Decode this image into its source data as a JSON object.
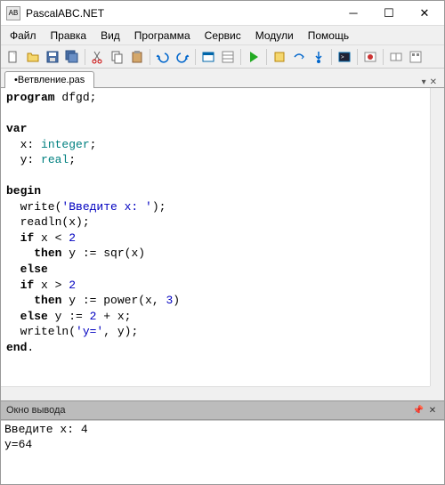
{
  "window": {
    "title": "PascalABC.NET",
    "icon_label": "AB"
  },
  "menu": {
    "file": "Файл",
    "edit": "Правка",
    "view": "Вид",
    "program": "Программа",
    "service": "Сервис",
    "modules": "Модули",
    "help": "Помощь"
  },
  "tabs": {
    "active": "•Ветвление.pas",
    "dropdown": "▾",
    "close": "✕"
  },
  "code": {
    "l1a": "program",
    "l1b": " dfgd;",
    "l3": "var",
    "l4a": "  x: ",
    "l4b": "integer",
    "l4c": ";",
    "l5a": "  y: ",
    "l5b": "real",
    "l5c": ";",
    "l7": "begin",
    "l8a": "  write(",
    "l8b": "'Введите x: '",
    "l8c": ");",
    "l9": "  readln(x);",
    "l10a": "  ",
    "l10b": "if",
    "l10c": " x < ",
    "l10d": "2",
    "l11a": "    ",
    "l11b": "then",
    "l11c": " y := sqr(x)",
    "l12a": "  ",
    "l12b": "else",
    "l13a": "  ",
    "l13b": "if",
    "l13c": " x > ",
    "l13d": "2",
    "l14a": "    ",
    "l14b": "then",
    "l14c": " y := power(x, ",
    "l14d": "3",
    "l14e": ")",
    "l15a": "  ",
    "l15b": "else",
    "l15c": " y := ",
    "l15d": "2",
    "l15e": " + x;",
    "l16a": "  writeln(",
    "l16b": "'y='",
    "l16c": ", y);",
    "l17": "end",
    "l17b": "."
  },
  "output_panel": {
    "title": "Окно вывода",
    "content": "Введите x: 4\ny=64"
  }
}
